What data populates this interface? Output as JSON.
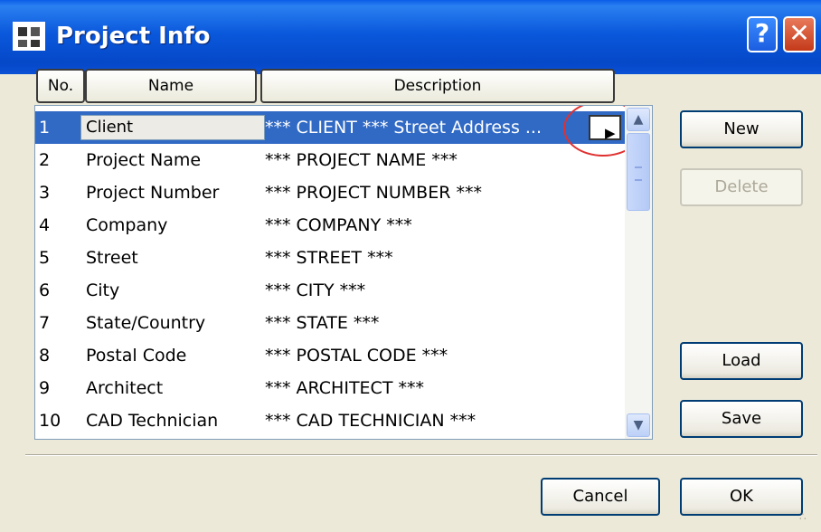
{
  "window": {
    "title": "Project Info",
    "help_label": "?",
    "close_label": "✕"
  },
  "columns": {
    "no": "No.",
    "name": "Name",
    "description": "Description"
  },
  "rows": [
    {
      "no": "1",
      "name": "Client",
      "description": "*** CLIENT *** Street Address ..."
    },
    {
      "no": "2",
      "name": "Project Name",
      "description": "*** PROJECT NAME ***"
    },
    {
      "no": "3",
      "name": "Project Number",
      "description": "*** PROJECT NUMBER ***"
    },
    {
      "no": "4",
      "name": "Company",
      "description": "*** COMPANY ***"
    },
    {
      "no": "5",
      "name": "Street",
      "description": "*** STREET ***"
    },
    {
      "no": "6",
      "name": "City",
      "description": "*** CITY ***"
    },
    {
      "no": "7",
      "name": "State/Country",
      "description": "*** STATE ***"
    },
    {
      "no": "8",
      "name": "Postal Code",
      "description": "*** POSTAL CODE ***"
    },
    {
      "no": "9",
      "name": "Architect",
      "description": "*** ARCHITECT ***"
    },
    {
      "no": "10",
      "name": "CAD Technician",
      "description": "*** CAD TECHNICIAN ***"
    }
  ],
  "selected_row": 1,
  "buttons": {
    "new": "New",
    "delete": "Delete",
    "load": "Load",
    "save": "Save",
    "cancel": "Cancel",
    "ok": "OK"
  },
  "icons": {
    "expand": "triangle-right-icon",
    "scroll_up": "chevron-up-icon",
    "scroll_down": "chevron-down-icon",
    "app": "project-info-icon"
  },
  "colors": {
    "title_bar": "#0a58dc",
    "selection": "#316ac5",
    "highlight_circle": "#e03030"
  }
}
